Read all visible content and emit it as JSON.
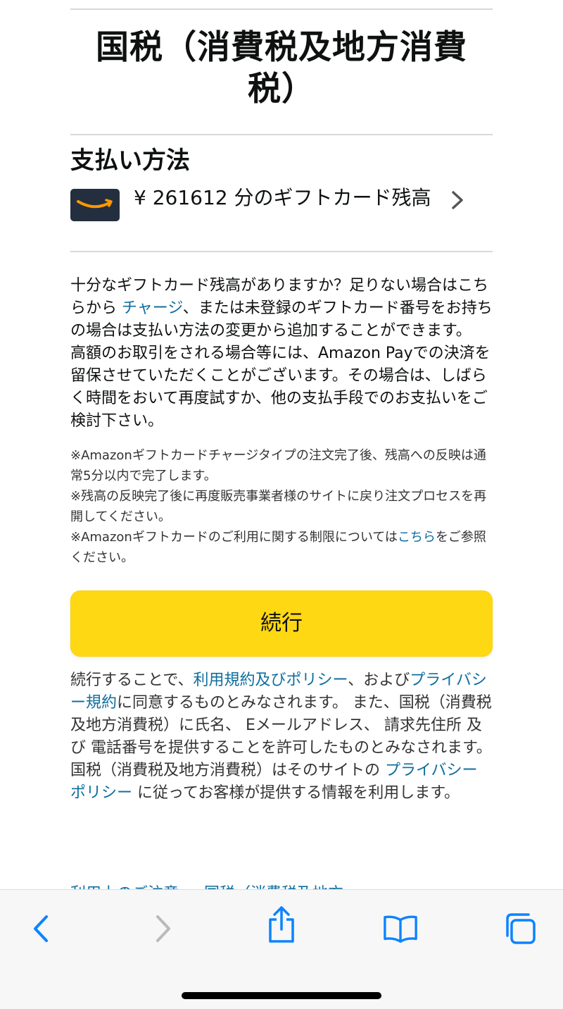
{
  "merchant": {
    "title": "国税（消費税及地方消費税）"
  },
  "payment_method": {
    "heading": "支払い方法",
    "balance": "¥ 261612  分のギフトカード残高"
  },
  "info": {
    "p1_before": "十分なギフトカード残高がありますか？足りない場合はこちらから ",
    "p1_link": "チャージ",
    "p1_after": "、または未登録のギフトカード番号をお持ちの場合は支払い方法の変更から追加することができます。",
    "p2": "高額のお取引をされる場合等には、Amazon Payでの決済を留保させていただくことがございます。その場合は、しばらく時間をおいて再度試すか、他の支払手段でのお支払いをご検討下さい。"
  },
  "notes": {
    "n1": "※Amazonギフトカードチャージタイプの注文完了後、残高への反映は通常5分以内で完了します。",
    "n2": "※残高の反映完了後に再度販売事業者様のサイトに戻り注文プロセスを再開してください。",
    "n3_before": "※Amazonギフトカードのご利用に関する制限については",
    "n3_link": "こちら",
    "n3_after": "をご参照ください。"
  },
  "continue_label": "続行",
  "terms": {
    "t1": "続行することで、",
    "link1": "利用規約及びポリシー",
    "t2": "、および",
    "link2": "プライバシー規約",
    "t3": "に同意するものとみなされます。 また、国税（消費税及地方消費税）に氏名、 Eメールアドレス、 請求先住所 及び 電話番号を提供することを許可したものとみなされます。 国税（消費税及地方消費税）はそのサイトの ",
    "link3": "プライバシーポリシー",
    "t4": " に従ってお客様が提供する情報を利用します。"
  },
  "cut_text": "利用上のご注意 ・ 国税（消費税及地方",
  "colors": {
    "button_yellow": "#ffd814",
    "link_blue": "#0f6e9e",
    "safari_blue": "#0a84ff",
    "card_navy": "#232f3e",
    "smile_orange": "#ff9900"
  },
  "toolbar": {
    "icons": [
      "chevron-left-icon",
      "chevron-right-icon",
      "share-icon",
      "book-icon",
      "tabs-icon"
    ]
  }
}
